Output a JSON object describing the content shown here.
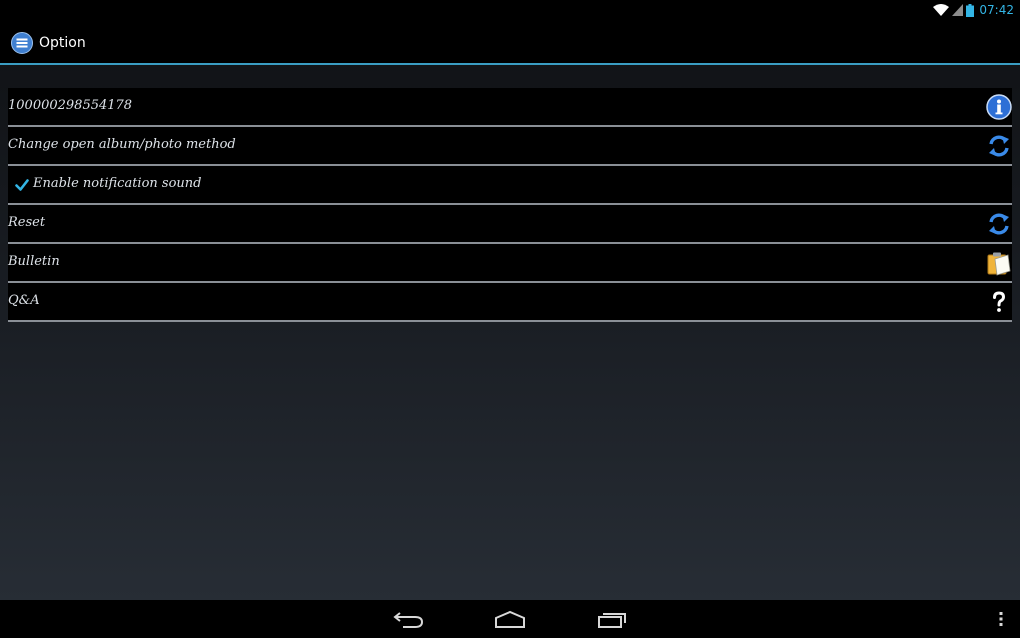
{
  "status_bar": {
    "time": "07:42",
    "icons": [
      "wifi-icon",
      "signal-icon",
      "battery-icon"
    ]
  },
  "action_bar": {
    "title": "Option",
    "icon": "menu-icon",
    "accent_color": "#3a9dc3"
  },
  "options": [
    {
      "label": "100000298554178",
      "icon": "info-icon"
    },
    {
      "label": "Change open album/photo method",
      "icon": "refresh-icon"
    },
    {
      "label": "Enable notification sound",
      "checkbox": true,
      "checked": true
    },
    {
      "label": "Reset",
      "icon": "refresh-icon"
    },
    {
      "label": "Bulletin",
      "icon": "clipboard-icon"
    },
    {
      "label": "Q&A",
      "icon": "question-icon"
    }
  ],
  "nav_bar": {
    "buttons": [
      "back-icon",
      "home-icon",
      "recent-apps-icon",
      "overflow-menu-icon"
    ]
  }
}
